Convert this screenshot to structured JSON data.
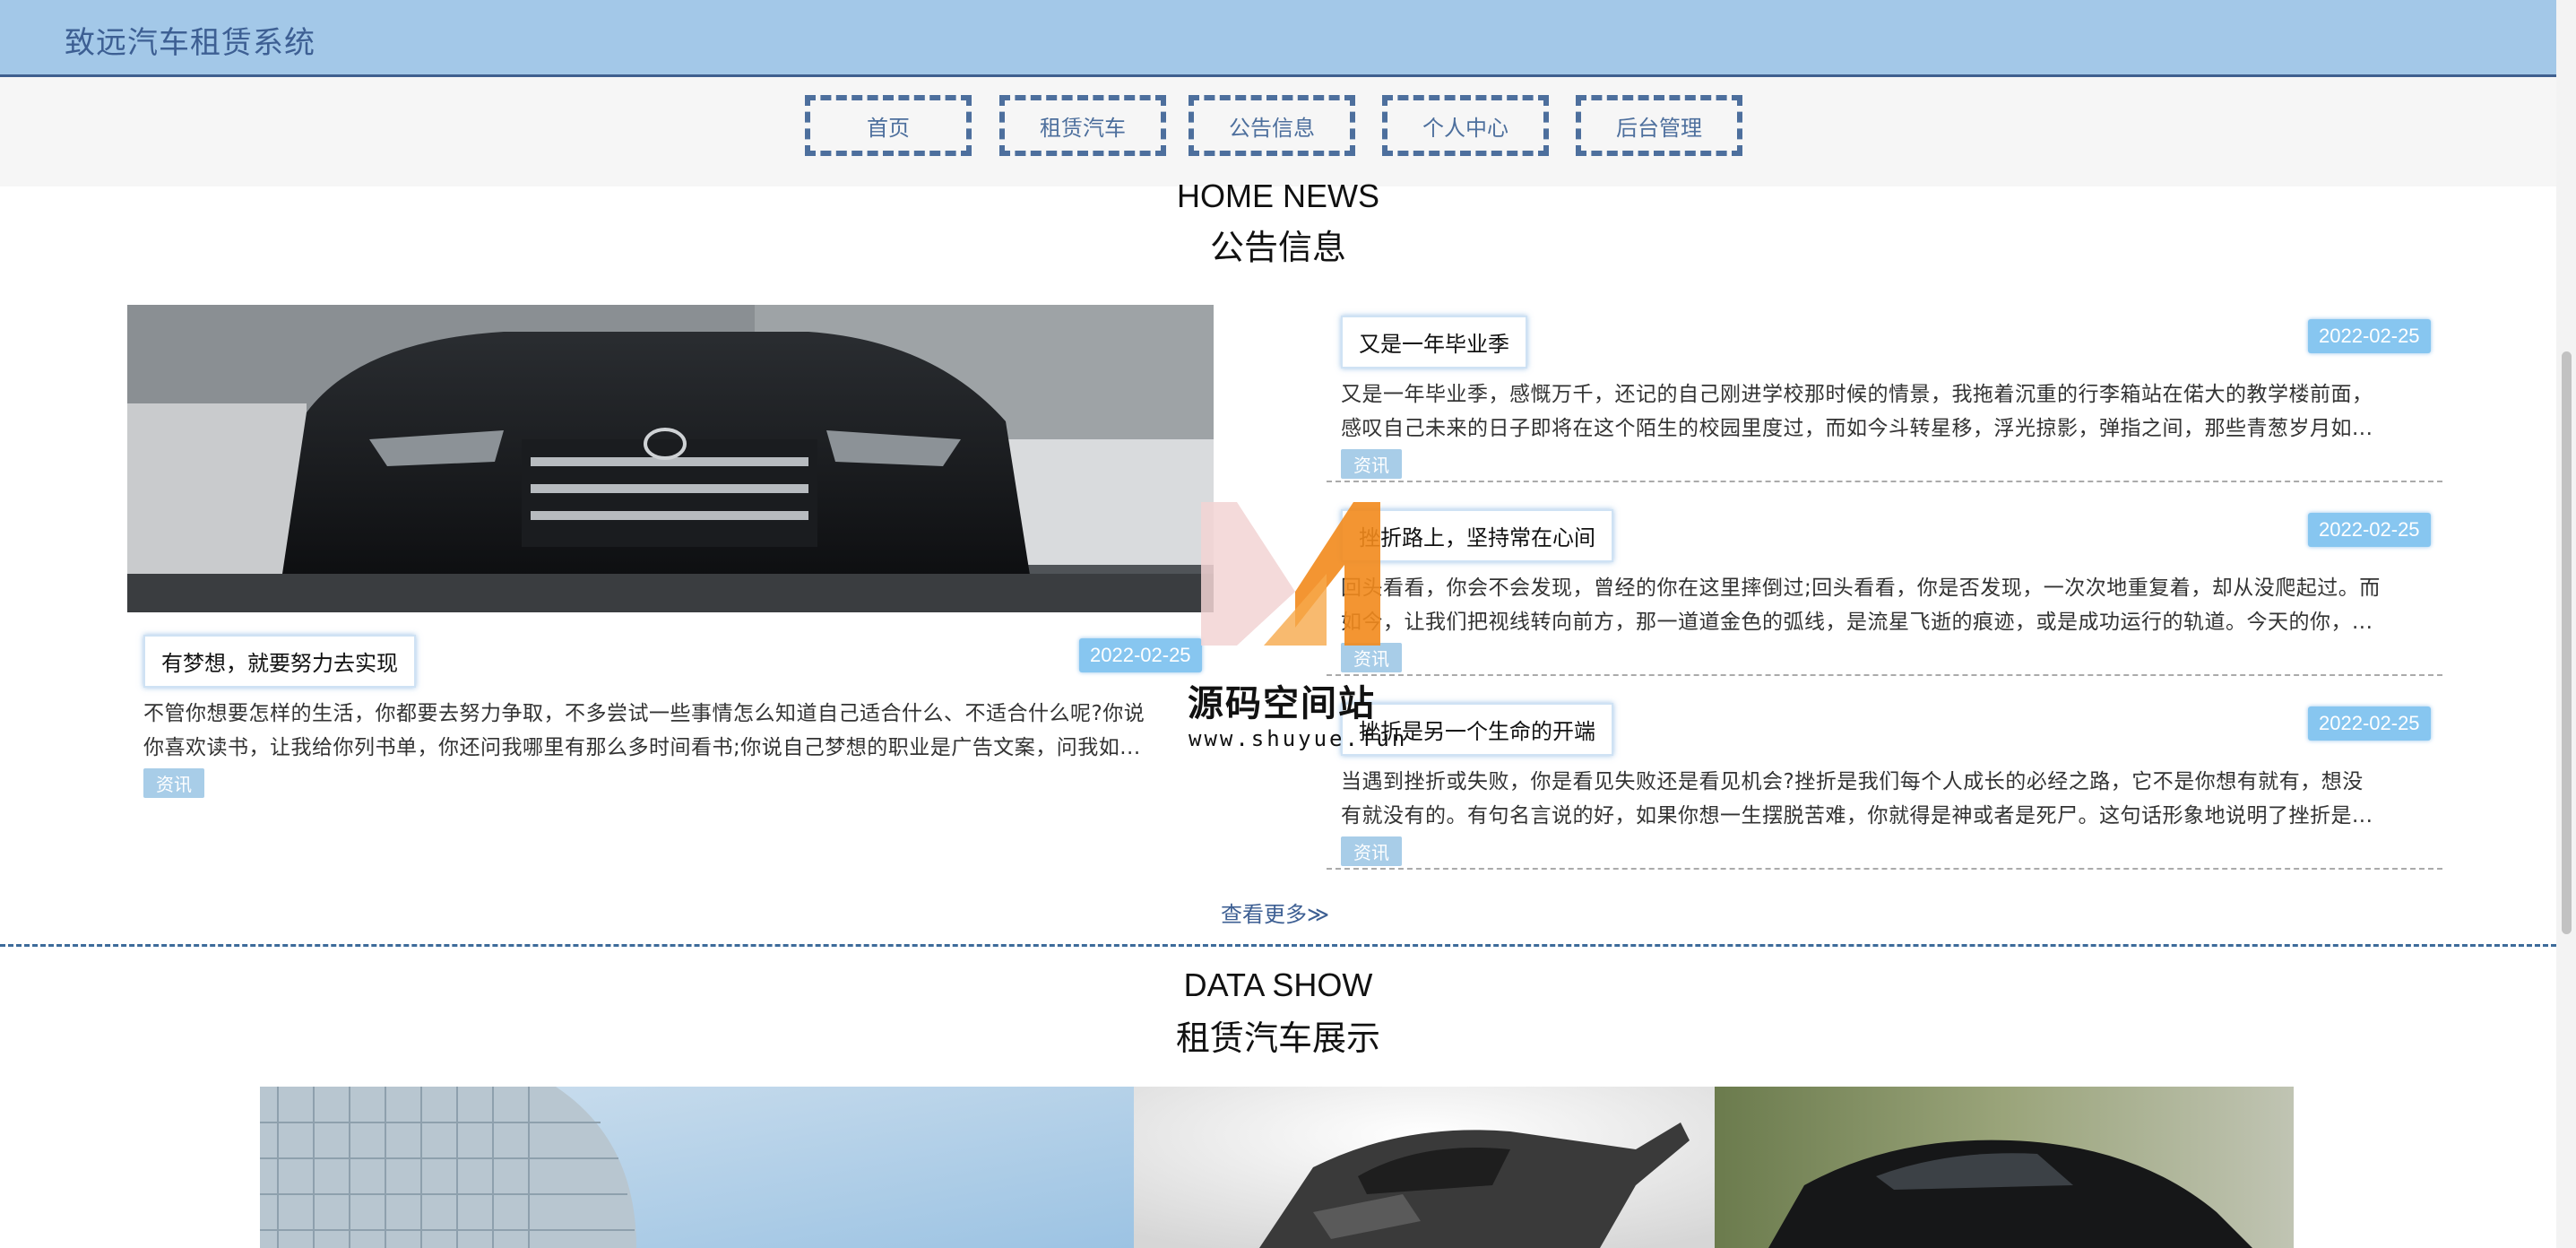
{
  "header": {
    "title": "致远汽车租赁系统"
  },
  "nav": {
    "items": [
      {
        "label": "首页"
      },
      {
        "label": "租赁汽车"
      },
      {
        "label": "公告信息"
      },
      {
        "label": "个人中心"
      },
      {
        "label": "后台管理"
      }
    ]
  },
  "news": {
    "heading_en": "HOME NEWS",
    "heading_cn": "公告信息",
    "featured": {
      "title": "有梦想，就要努力去实现",
      "date": "2022-02-25",
      "summary_line1": "不管你想要怎样的生活，你都要去努力争取，不多尝试一些事情怎么知道自己适合什么、不适合什么呢?你说",
      "summary_line2": "你喜欢读书，让我给你列书单，你还问我哪里有那么多时间看书;你说自己梦想的职业是广告文案，问我如...",
      "tag": "资讯"
    },
    "items": [
      {
        "title": "又是一年毕业季",
        "date": "2022-02-25",
        "summary_line1": "又是一年毕业季，感慨万千，还记的自己刚进学校那时候的情景，我拖着沉重的行李箱站在偌大的教学楼前面，",
        "summary_line2": "感叹自己未来的日子即将在这个陌生的校园里度过，而如今斗转星移，浮光掠影，弹指之间，那些青葱岁月如...",
        "tag": "资讯"
      },
      {
        "title": "挫折路上，坚持常在心间",
        "date": "2022-02-25",
        "summary_line1": "回头看看，你会不会发现，曾经的你在这里摔倒过;回头看看，你是否发现，一次次地重复着，却从没爬起过。而",
        "summary_line2": "如今，让我们把视线转向前方，那一道道金色的弧线，是流星飞逝的痕迹，或是成功运行的轨道。今天的你，...",
        "tag": "资讯"
      },
      {
        "title": "挫折是另一个生命的开端",
        "date": "2022-02-25",
        "summary_line1": "当遇到挫折或失败，你是看见失败还是看见机会?挫折是我们每个人成长的必经之路，它不是你想有就有，想没",
        "summary_line2": "有就没有的。有句名言说的好，如果你想一生摆脱苦难，你就得是神或者是死尸。这句话形象地说明了挫折是...",
        "tag": "资讯"
      }
    ],
    "more_label": "查看更多≫"
  },
  "data_show": {
    "heading_en": "DATA SHOW",
    "heading_cn": "租赁汽车展示"
  },
  "watermark": {
    "text": "源码空间站",
    "url": "www.shuyue.fun"
  },
  "colors": {
    "header_bg": "#a3c8e8",
    "brand_text": "#3d5f93",
    "date_badge": "#87c6f0",
    "tag_bg": "#a8cde8"
  }
}
